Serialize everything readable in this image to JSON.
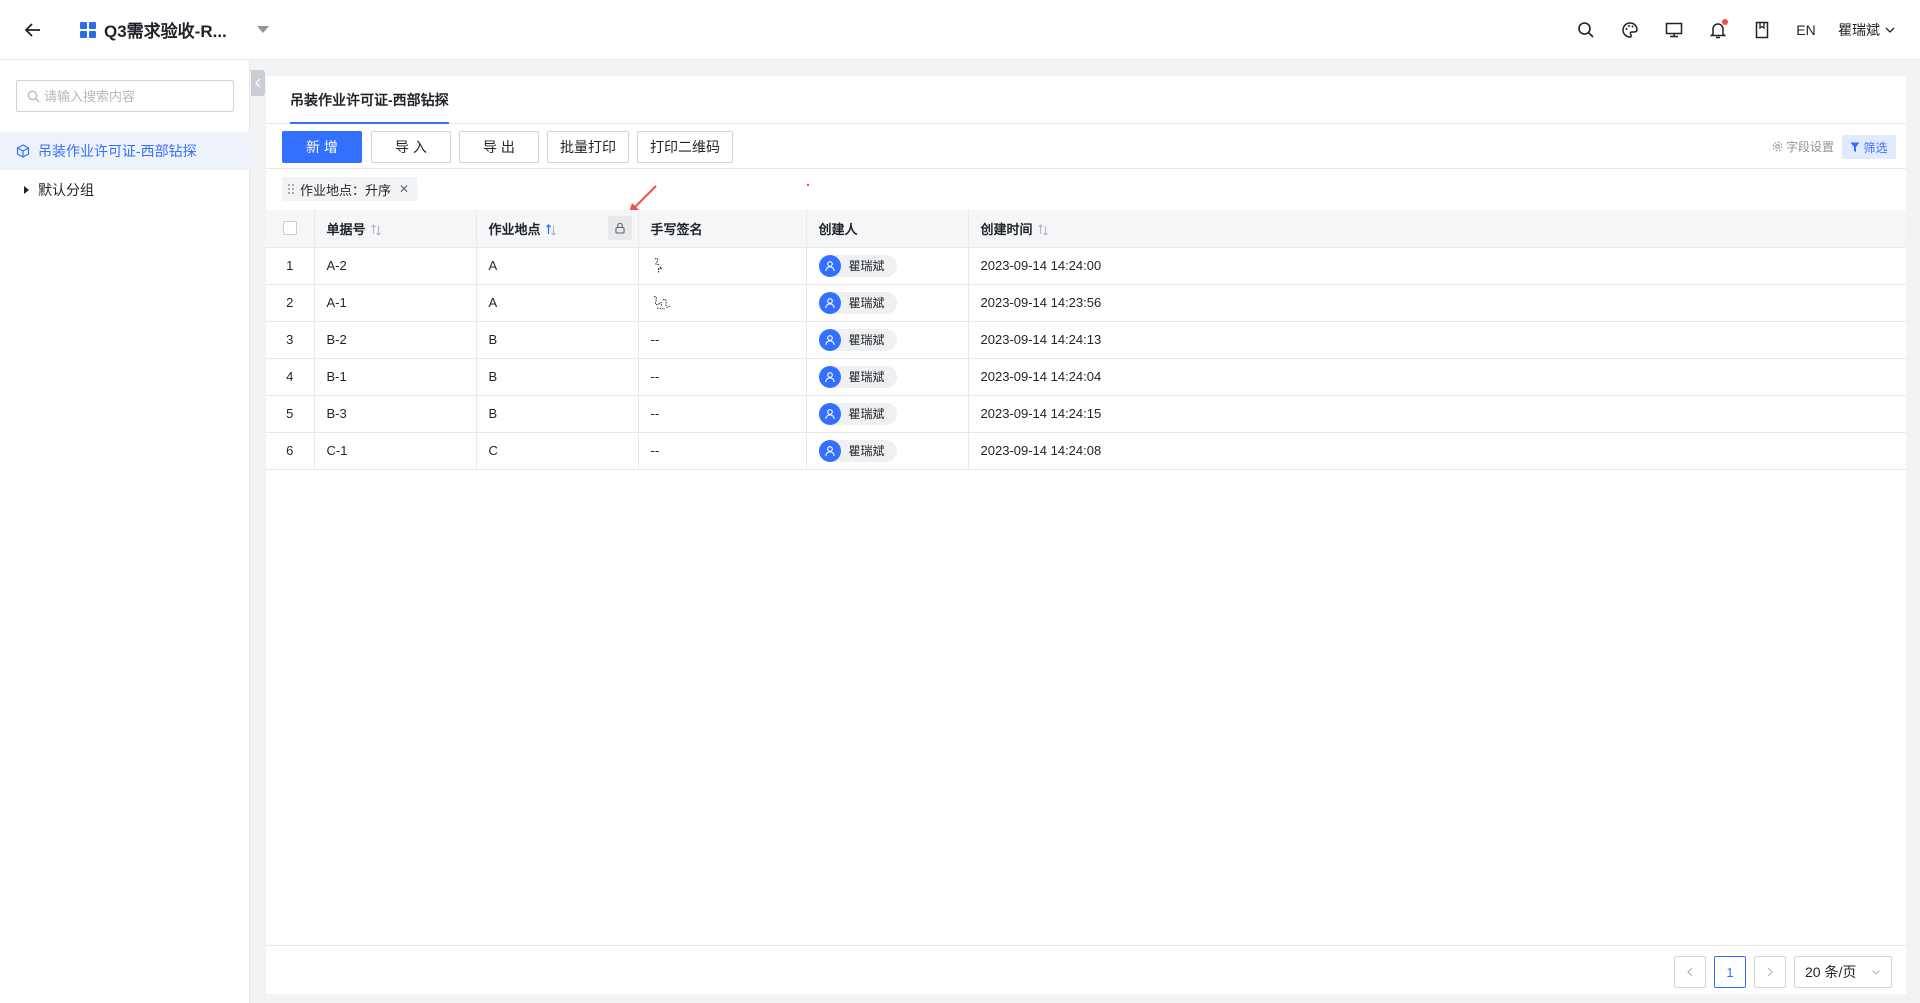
{
  "header": {
    "title": "Q3需求验收-R...",
    "lang": "EN",
    "user": "瞿瑞斌"
  },
  "sidebar": {
    "search_placeholder": "请输入搜索内容",
    "root_item": "吊装作业许可证-西部钻探",
    "child_item": "默认分组"
  },
  "main": {
    "tab": "吊装作业许可证-西部钻探",
    "toolbar": {
      "add": "新 增",
      "import": "导 入",
      "export": "导 出",
      "batch_print": "批量打印",
      "print_qr": "打印二维码",
      "field_settings": "字段设置",
      "filter": "筛选"
    },
    "sort_chip": "作业地点：升序",
    "columns": [
      "单据号",
      "作业地点",
      "手写签名",
      "创建人",
      "创建时间"
    ],
    "rows": [
      {
        "idx": "1",
        "doc": "A-2",
        "location": "A",
        "signature": "",
        "creator": "瞿瑞斌",
        "created": "2023-09-14 14:24:00"
      },
      {
        "idx": "2",
        "doc": "A-1",
        "location": "A",
        "signature": "",
        "creator": "瞿瑞斌",
        "created": "2023-09-14 14:23:56"
      },
      {
        "idx": "3",
        "doc": "B-2",
        "location": "B",
        "signature": "--",
        "creator": "瞿瑞斌",
        "created": "2023-09-14 14:24:13"
      },
      {
        "idx": "4",
        "doc": "B-1",
        "location": "B",
        "signature": "--",
        "creator": "瞿瑞斌",
        "created": "2023-09-14 14:24:04"
      },
      {
        "idx": "5",
        "doc": "B-3",
        "location": "B",
        "signature": "--",
        "creator": "瞿瑞斌",
        "created": "2023-09-14 14:24:15"
      },
      {
        "idx": "6",
        "doc": "C-1",
        "location": "C",
        "signature": "--",
        "creator": "瞿瑞斌",
        "created": "2023-09-14 14:24:08"
      }
    ]
  },
  "pagination": {
    "current_page": "1",
    "page_size": "20 条/页"
  },
  "colors": {
    "accent": "#3370ff",
    "notification_dot": "#f54a45"
  }
}
